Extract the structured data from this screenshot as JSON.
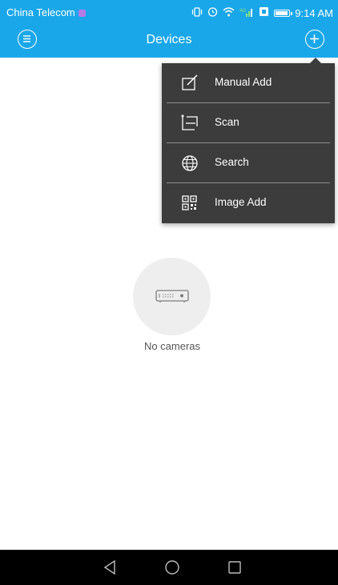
{
  "status_bar": {
    "carrier": "China Telecom",
    "time": "9:14 AM",
    "battery_level": 1.0,
    "icons": [
      "vibrate-icon",
      "alarm-icon",
      "wifi-icon",
      "signal-icon",
      "sim-icon",
      "battery-icon"
    ]
  },
  "app_bar": {
    "title": "Devices",
    "left_icon": "menu-icon",
    "right_icon": "add-icon",
    "color": "#1aa7ea"
  },
  "popup_menu": {
    "items": [
      {
        "label": "Manual Add",
        "icon": "edit-icon"
      },
      {
        "label": "Scan",
        "icon": "scan-icon"
      },
      {
        "label": "Search",
        "icon": "globe-icon"
      },
      {
        "label": "Image Add",
        "icon": "qr-code-icon"
      }
    ]
  },
  "empty_state": {
    "icon": "dvr-device-icon",
    "text": "No cameras"
  },
  "nav_bar": {
    "buttons": [
      "back-icon",
      "home-icon",
      "recents-icon"
    ]
  }
}
